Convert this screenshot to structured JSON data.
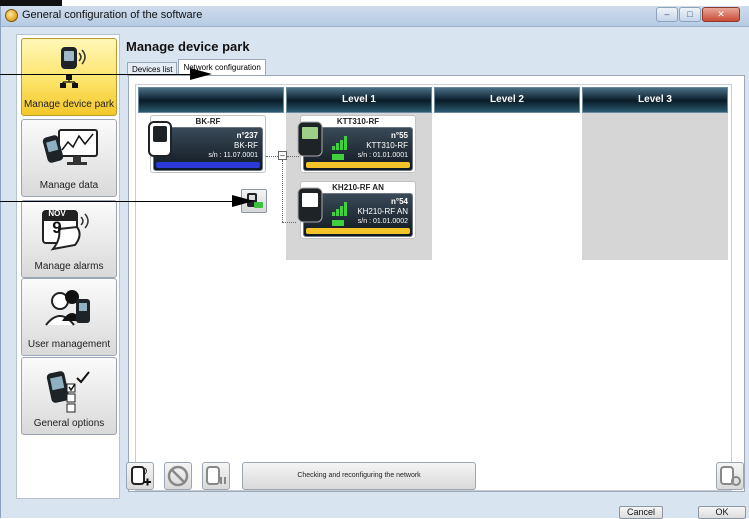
{
  "window": {
    "title": "General configuration of the software"
  },
  "sidebar": {
    "items": [
      {
        "label": "Manage device park",
        "icon": "device-network-icon",
        "active": true
      },
      {
        "label": "Manage data",
        "icon": "chart-monitor-icon",
        "active": false
      },
      {
        "label": "Manage alarms",
        "icon": "calendar-alarm-icon",
        "active": false,
        "calendar_month": "NOV",
        "calendar_day": "9"
      },
      {
        "label": "User management",
        "icon": "users-icon",
        "active": false
      },
      {
        "label": "General options",
        "icon": "options-device-icon",
        "active": false
      }
    ]
  },
  "main": {
    "title": "Manage device park",
    "tabs": [
      {
        "label": "Devices list",
        "active": false
      },
      {
        "label": "Network configuration",
        "active": true
      }
    ],
    "levels": [
      "",
      "Level 1",
      "Level 2",
      "Level 3"
    ],
    "devices": {
      "root": {
        "name": "BK-RF",
        "number": "n°237",
        "model": "BK-RF",
        "serial": "s/n : 11.07.0001",
        "bar_color": "#2a39d8"
      },
      "level1": [
        {
          "name": "KTT310-RF",
          "number": "n°55",
          "model": "KTT310-RF",
          "serial": "s/n : 01.01.0001",
          "bar_color": "#f3c32a"
        },
        {
          "name": "KH210-RF AN",
          "number": "n°54",
          "model": "KH210-RF AN",
          "serial": "s/n : 01.01.0002",
          "bar_color": "#f3c32a"
        }
      ]
    }
  },
  "toolbar": {
    "check_label": "Checking and reconfiguring the network"
  },
  "dialog": {
    "cancel_label": "Cancel",
    "ok_label": "OK"
  },
  "colors": {
    "active_nav": "#fde46a",
    "level_header": "#0f2230",
    "accent_blue": "#2a39d8",
    "accent_yellow": "#f3c32a"
  }
}
